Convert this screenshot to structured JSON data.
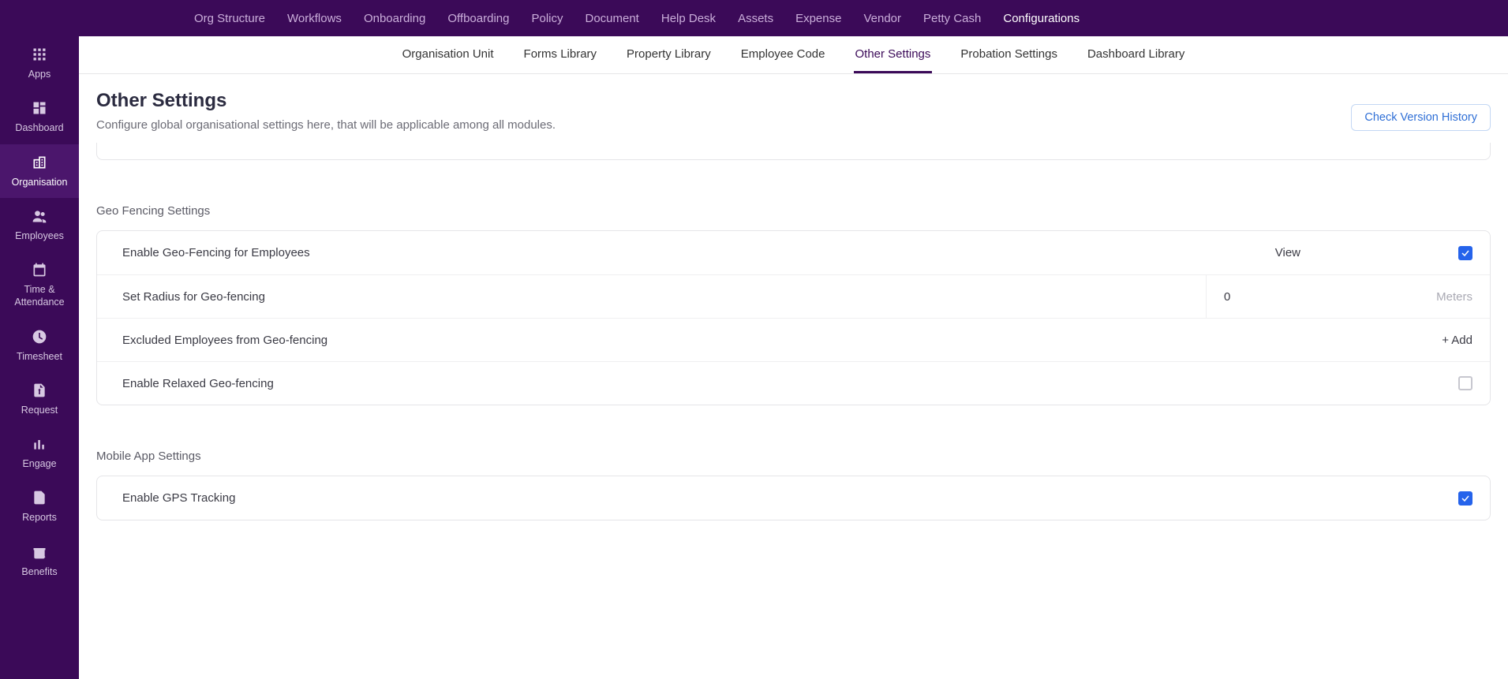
{
  "topnav": {
    "items": [
      {
        "label": "Org Structure"
      },
      {
        "label": "Workflows"
      },
      {
        "label": "Onboarding"
      },
      {
        "label": "Offboarding"
      },
      {
        "label": "Policy"
      },
      {
        "label": "Document"
      },
      {
        "label": "Help Desk"
      },
      {
        "label": "Assets"
      },
      {
        "label": "Expense"
      },
      {
        "label": "Vendor"
      },
      {
        "label": "Petty Cash"
      },
      {
        "label": "Configurations",
        "active": true
      }
    ]
  },
  "sidebar": {
    "items": [
      {
        "label": "Apps",
        "icon": "apps-icon"
      },
      {
        "label": "Dashboard",
        "icon": "dashboard-icon"
      },
      {
        "label": "Organisation",
        "icon": "organisation-icon",
        "active": true
      },
      {
        "label": "Employees",
        "icon": "employees-icon"
      },
      {
        "label": "Time & Attendance",
        "icon": "time-attendance-icon"
      },
      {
        "label": "Timesheet",
        "icon": "timesheet-icon"
      },
      {
        "label": "Request",
        "icon": "request-icon"
      },
      {
        "label": "Engage",
        "icon": "engage-icon"
      },
      {
        "label": "Reports",
        "icon": "reports-icon"
      },
      {
        "label": "Benefits",
        "icon": "benefits-icon"
      }
    ]
  },
  "subnav": {
    "items": [
      {
        "label": "Organisation Unit"
      },
      {
        "label": "Forms Library"
      },
      {
        "label": "Property Library"
      },
      {
        "label": "Employee Code"
      },
      {
        "label": "Other Settings",
        "active": true
      },
      {
        "label": "Probation Settings"
      },
      {
        "label": "Dashboard Library"
      }
    ]
  },
  "page": {
    "title": "Other Settings",
    "description": "Configure global organisational settings here, that will be applicable among all modules.",
    "history_button": "Check Version History"
  },
  "sections": {
    "geo": {
      "title": "Geo Fencing Settings",
      "rows": {
        "enable": {
          "label": "Enable Geo-Fencing for Employees",
          "view": "View",
          "checked": true
        },
        "radius": {
          "label": "Set Radius for Geo-fencing",
          "value": "0",
          "unit": "Meters"
        },
        "excluded": {
          "label": "Excluded Employees from Geo-fencing",
          "add": "+ Add"
        },
        "relaxed": {
          "label": "Enable Relaxed Geo-fencing",
          "checked": false
        }
      }
    },
    "mobile": {
      "title": "Mobile App Settings",
      "rows": {
        "gps": {
          "label": "Enable GPS Tracking",
          "checked": true
        }
      }
    }
  }
}
